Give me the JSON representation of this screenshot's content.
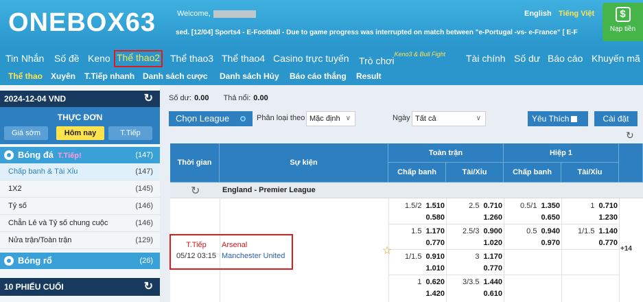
{
  "header": {
    "logo": "ONEBOX63",
    "welcome": "Welcome,",
    "ticker": "sed.     [12/04] Sports4 - E-Football - Due to game progress was interrupted on match between \"e-Portugal -vs- e-France\" [ E-F",
    "lang_en": "English",
    "lang_vi": "Tiếng Việt",
    "deposit_label": "Nạp tiền",
    "deposit_icon": "dollar-icon"
  },
  "nav": {
    "items": [
      "Tin Nhắn",
      "Số đề",
      "Keno",
      "Thể thao2",
      "Thể thao3",
      "Thể thao4",
      "Casino trực tuyến",
      "Trò chơi",
      "Tài chính",
      "Số dư",
      "Báo cáo",
      "Khuyến mã"
    ],
    "game_tag": "Keno3 & Bull Fight"
  },
  "subnav": {
    "items": [
      "Thể thao",
      "Xuyên",
      "T.Tiếp nhanh",
      "Danh sách cược",
      "Danh sách Hủy",
      "Báo cáo thắng",
      "Result"
    ]
  },
  "sidebar": {
    "date": "2024-12-04 VND",
    "menu_title": "THỰC ĐƠN",
    "tabs": [
      "Giá sớm",
      "Hôm nay",
      "T.Tiếp"
    ],
    "football": {
      "label": "Bóng đá",
      "live": "T.Tiếp!",
      "count": "(147)"
    },
    "rows": [
      {
        "label": "Chấp banh & Tài Xỉu",
        "count": "(147)"
      },
      {
        "label": "1X2",
        "count": "(145)"
      },
      {
        "label": "Tỷ số",
        "count": "(146)"
      },
      {
        "label": "Chẵn Lẻ và Tỷ số chung cuộc",
        "count": "(146)"
      },
      {
        "label": "Nửa trận/Toàn trận",
        "count": "(129)"
      }
    ],
    "basketball": {
      "label": "Bóng rổ",
      "count": "(26)"
    },
    "last_tickets": "10 PHIẾU CUỐI"
  },
  "main": {
    "balance_label": "Số dư:",
    "balance": "0.00",
    "outstanding_label": "Thả nổi:",
    "outstanding": "0.00",
    "league_btn": "Chọn League",
    "sort_label": "Phân loại theo",
    "sort_value": "Mặc định",
    "day_label": "Ngày",
    "day_value": "Tất cả",
    "fav_label": "Yêu Thích",
    "setup_label": "Cài đặt"
  },
  "table": {
    "col_time": "Thời gian",
    "col_event": "Sự kiện",
    "full_time": "Toàn trận",
    "half": "Hiệp 1",
    "handicap": "Chấp banh",
    "over_under": "Tài/Xỉu",
    "league": "England - Premier League",
    "event": {
      "status": "T.Tiếp",
      "datetime": "05/12 03:15",
      "home": "Arsenal",
      "away": "Manchester United",
      "more": "+14"
    },
    "rows": [
      {
        "ft_hdp": "1.5/2",
        "ft_hdp_o1": "1.510",
        "ft_hdp_o2": "0.580",
        "ft_ou": "2.5",
        "ft_ou_o1": "0.710",
        "ft_ou_o2": "1.260",
        "h1_hdp": "0.5/1",
        "h1_hdp_o1": "1.350",
        "h1_hdp_o2": "0.650",
        "h1_ou": "1",
        "h1_ou_o1": "0.710",
        "h1_ou_o2": "1.230"
      },
      {
        "ft_hdp": "1.5",
        "ft_hdp_o1": "1.170",
        "ft_hdp_o2": "0.770",
        "ft_ou": "2.5/3",
        "ft_ou_o1": "0.900",
        "ft_ou_o2": "1.020",
        "h1_hdp": "0.5",
        "h1_hdp_o1": "0.940",
        "h1_hdp_o2": "0.970",
        "h1_ou": "1/1.5",
        "h1_ou_o1": "1.140",
        "h1_ou_o2": "0.770"
      },
      {
        "ft_hdp": "1/1.5",
        "ft_hdp_o1": "0.910",
        "ft_hdp_o2": "1.010",
        "ft_ou": "3",
        "ft_ou_o1": "1.170",
        "ft_ou_o2": "0.770",
        "h1_hdp": "",
        "h1_hdp_o1": "",
        "h1_hdp_o2": "",
        "h1_ou": "",
        "h1_ou_o1": "",
        "h1_ou_o2": ""
      },
      {
        "ft_hdp": "1",
        "ft_hdp_o1": "0.620",
        "ft_hdp_o2": "1.420",
        "ft_ou": "3/3.5",
        "ft_ou_o1": "1.440",
        "ft_ou_o2": "0.610",
        "h1_hdp": "",
        "h1_hdp_o1": "",
        "h1_hdp_o2": "",
        "h1_ou": "",
        "h1_ou_o1": "",
        "h1_ou_o2": ""
      }
    ]
  }
}
